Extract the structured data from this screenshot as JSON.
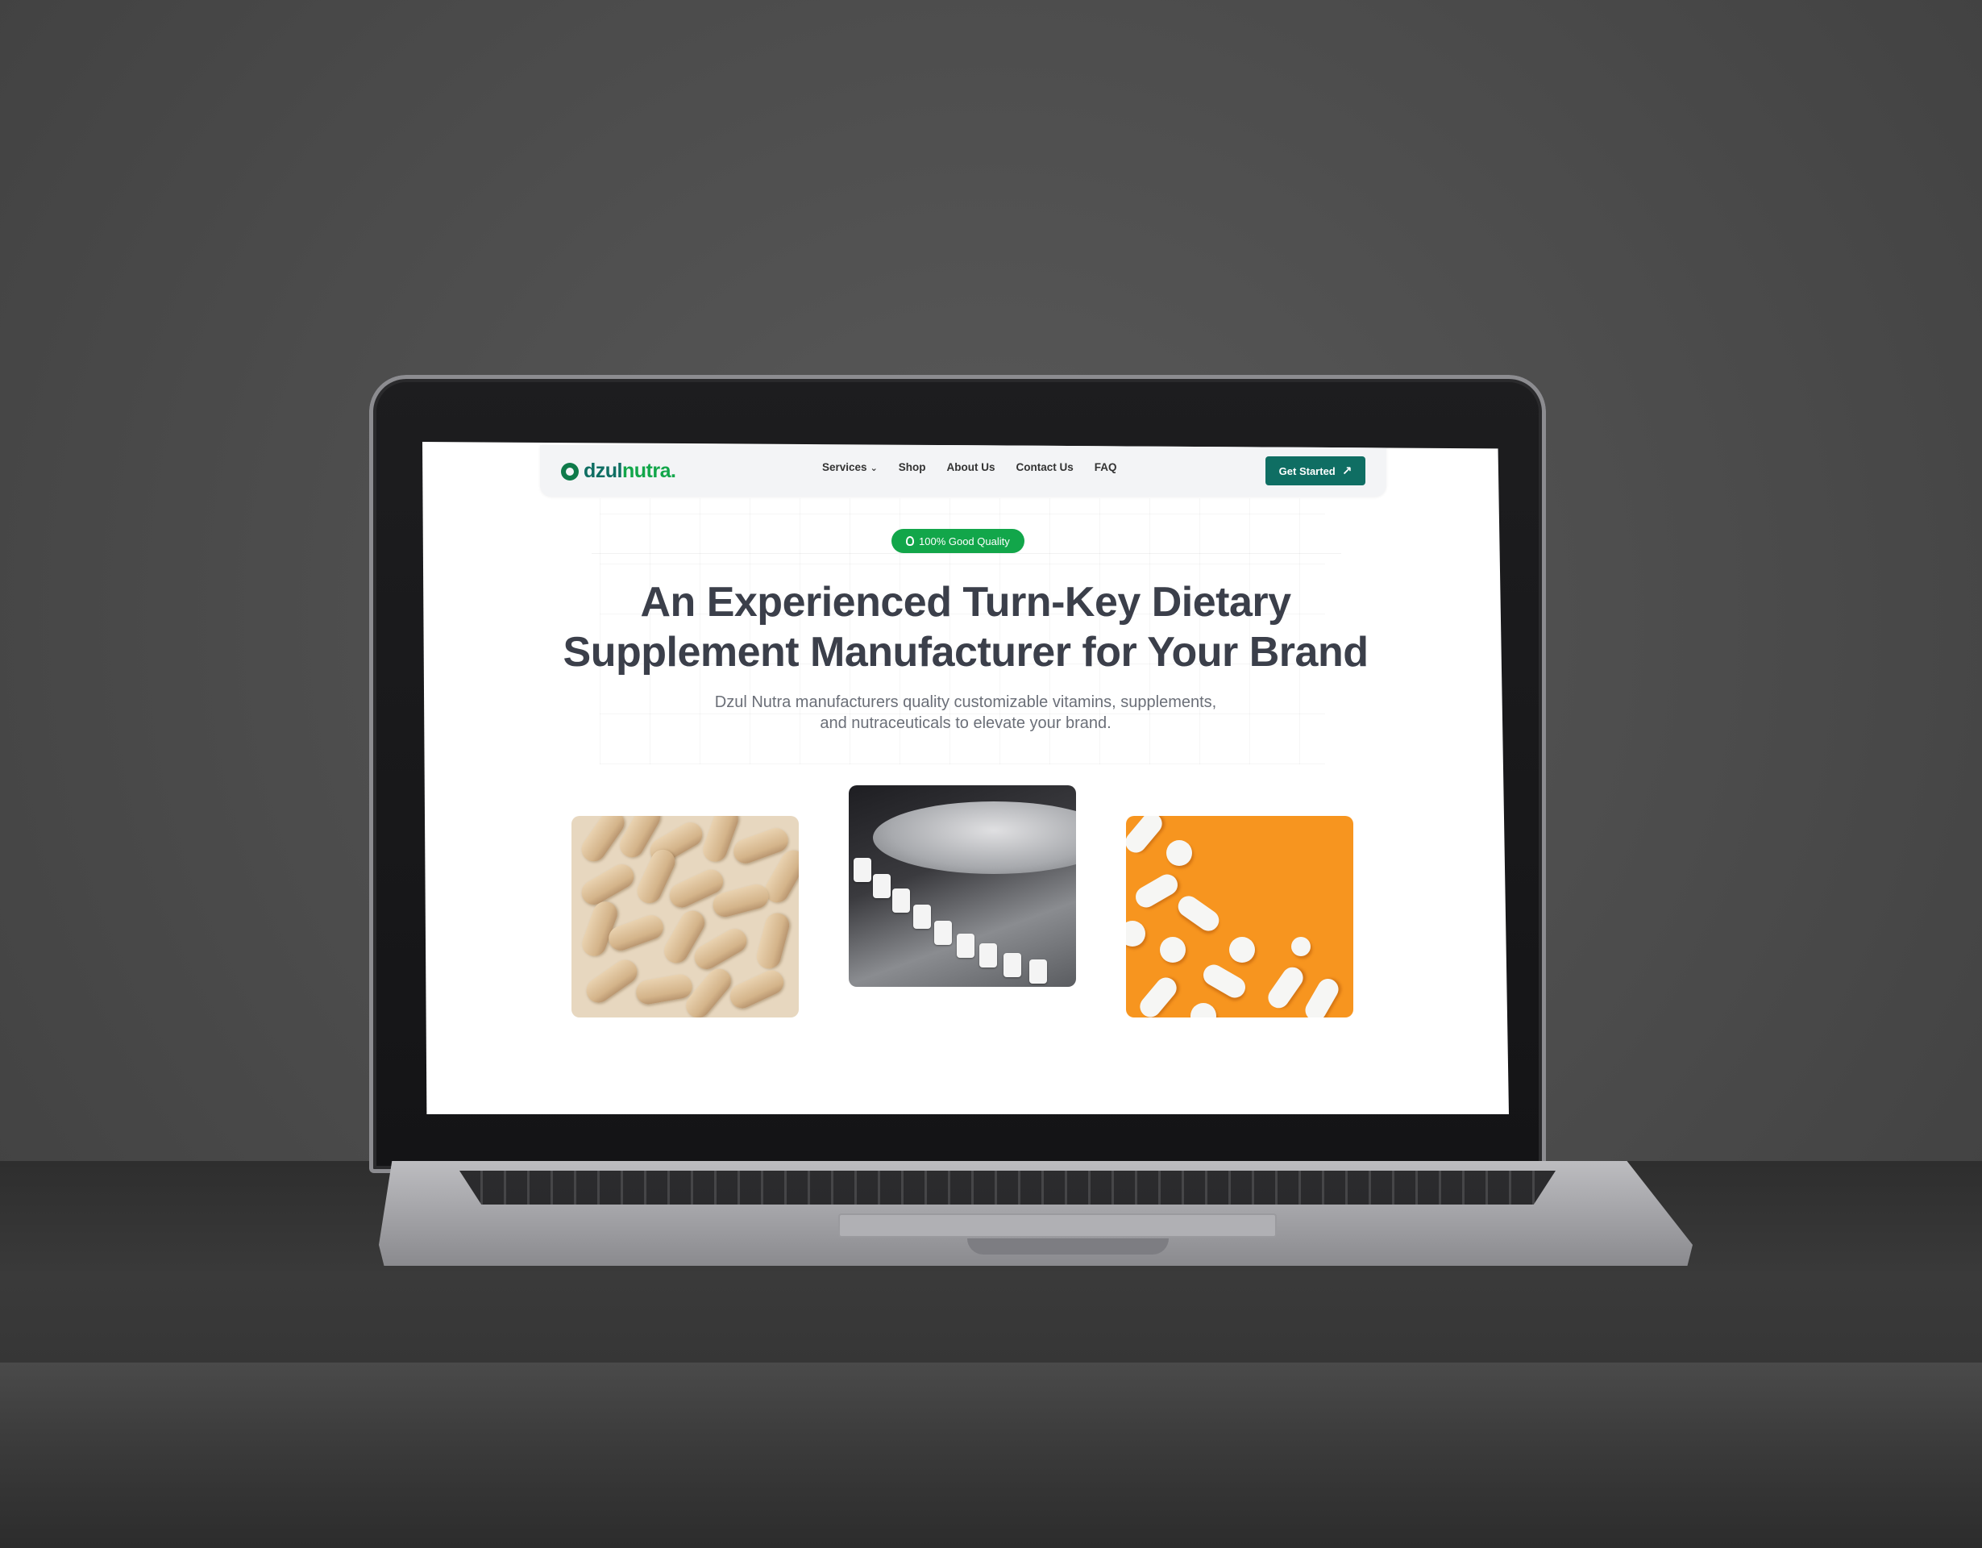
{
  "header": {
    "logo_text_primary": "dzul",
    "logo_text_secondary": "nutra.",
    "logo_icon": "flower-icon"
  },
  "nav": {
    "items": [
      {
        "label": "Services",
        "has_dropdown": true
      },
      {
        "label": "Shop"
      },
      {
        "label": "About Us"
      },
      {
        "label": "Contact Us"
      },
      {
        "label": "FAQ"
      }
    ],
    "cta_label": "Get Started",
    "cta_icon": "arrow-up-right-icon"
  },
  "hero": {
    "badge_label": "100% Good Quality",
    "badge_icon": "award-icon",
    "headline_line1": "An Experienced Turn-Key Dietary",
    "headline_line2": "Supplement Manufacturer for Your Brand",
    "sub_line1": "Dzul Nutra manufacturers quality customizable vitamins, supplements,",
    "sub_line2": "and nutraceuticals to elevate your brand."
  },
  "colors": {
    "brand_green": "#12a64a",
    "brand_teal": "#0f6e63",
    "headline": "#3b3f4a",
    "orange": "#f7951f"
  }
}
